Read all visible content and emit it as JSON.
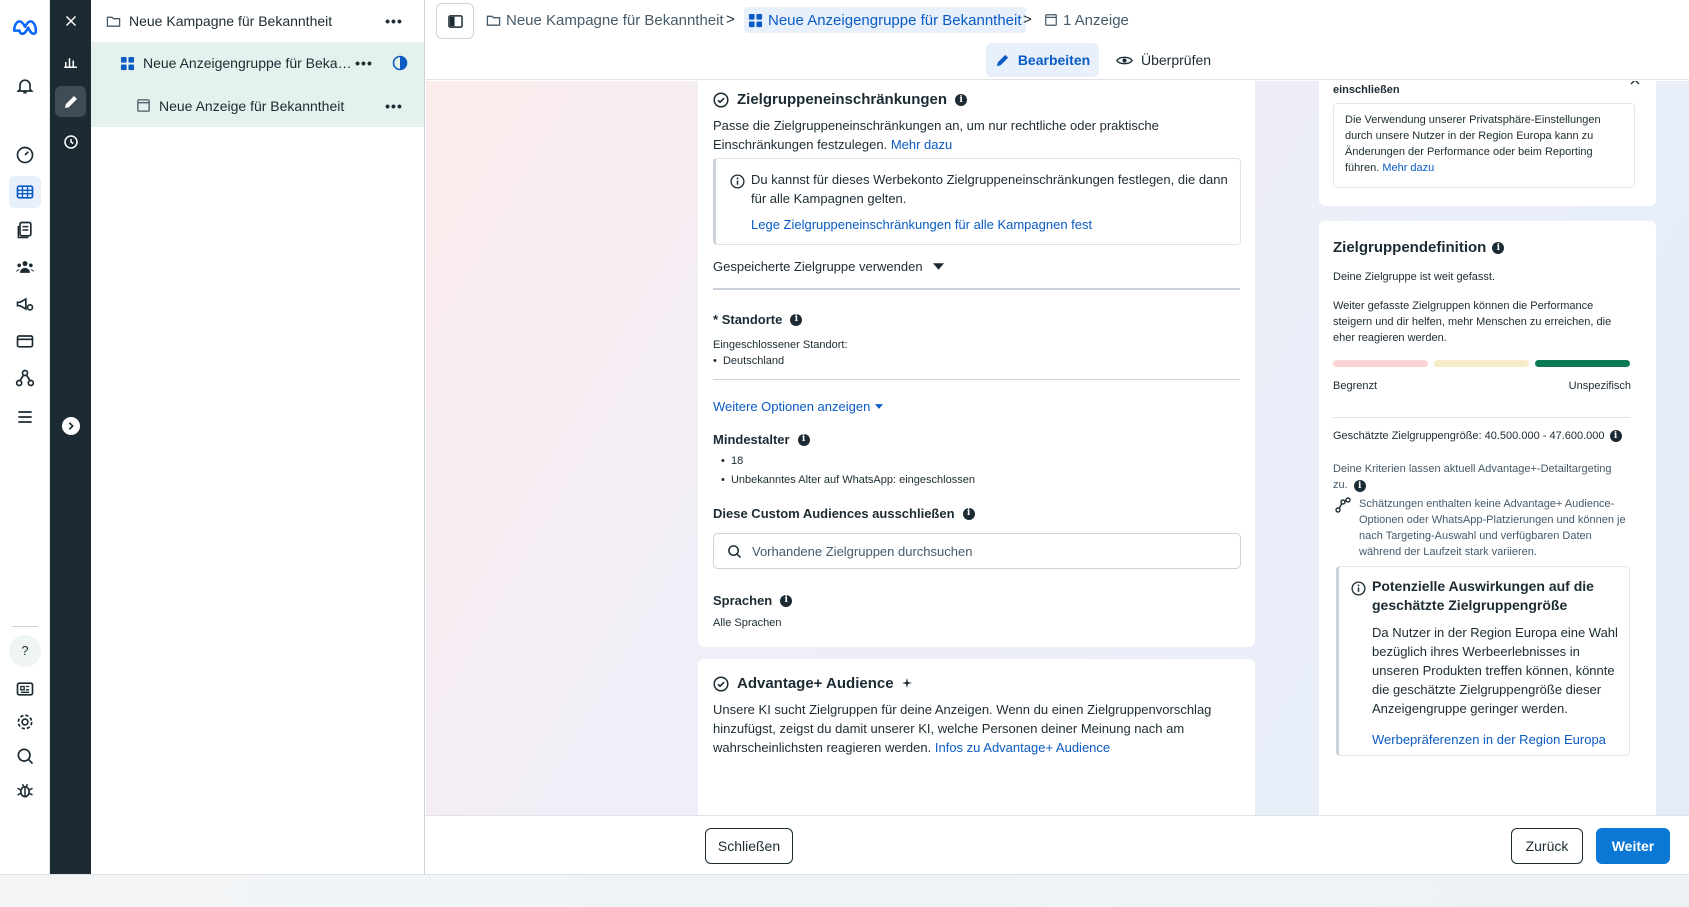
{
  "tree": {
    "campaign": "Neue Kampagne für Bekanntheit",
    "adset": "Neue Anzeigengruppe für Beka…",
    "ad": "Neue Anzeige für Bekanntheit"
  },
  "breadcrumb": {
    "campaign": "Neue Kampagne für Bekanntheit",
    "adset": "Neue Anzeigengruppe für Bekanntheit",
    "ad": "1 Anzeige"
  },
  "toolbar": {
    "edit_label": "Bearbeiten",
    "review_label": "Überprüfen"
  },
  "restrictions": {
    "title": "Zielgruppeneinschränkungen",
    "desc": "Passe die Zielgruppeneinschränkungen an, um nur rechtliche oder praktische Einschränkungen festzulegen.",
    "more": "Mehr dazu",
    "notice": "Du kannst für dieses Werbekonto Zielgruppeneinschränkungen festlegen, die dann für alle Kampagnen gelten.",
    "notice_link": "Lege Zielgruppeneinschränkungen für alle Kampagnen fest",
    "saved_audience": "Gespeicherte Zielgruppe verwenden",
    "locations_label": "Standorte",
    "locations_required": "*",
    "included_label": "Eingeschlossener Standort:",
    "location_1": "Deutschland",
    "more_options": "Weitere Optionen anzeigen",
    "min_age_label": "Mindestalter",
    "min_age_value": "18",
    "whatsapp_age": "Unbekanntes Alter auf WhatsApp: eingeschlossen",
    "exclude_label": "Diese Custom Audiences ausschließen",
    "search_placeholder": "Vorhandene Zielgruppen durchsuchen",
    "languages_label": "Sprachen",
    "languages_value": "Alle Sprachen"
  },
  "advantage": {
    "title": "Advantage+ Audience",
    "desc": "Unsere KI sucht Zielgruppen für deine Anzeigen. Wenn du einen Zielgruppenvorschlag hinzufügst, zeigst du damit unserer KI, welche Personen deiner Meinung nach am wahrscheinlichsten reagieren werden.",
    "link": "Infos zu Advantage+ Audience"
  },
  "privacy": {
    "heading": "einschließen",
    "text": "Die Verwendung unserer Privatsphäre-Einstellungen durch unsere Nutzer in der Region Europa kann zu Änderungen der Performance oder beim Reporting führen.",
    "link": "Mehr dazu"
  },
  "definition": {
    "title": "Zielgruppendefinition",
    "broad": "Deine Zielgruppe ist weit gefasst.",
    "explain": "Weiter gefasste Zielgruppen können die Performance steigern und dir helfen, mehr Menschen zu erreichen, die eher reagieren werden.",
    "meter_level": 1.0,
    "left_label": "Begrenzt",
    "right_label": "Unspezifisch",
    "size": "Geschätzte Zielgruppengröße: 40.500.000 - 47.600.000",
    "criteria": "Deine Kriterien lassen aktuell Advantage+-Detailtargeting zu.",
    "estimates": "Schätzungen enthalten keine Advantage+ Audience-Optionen oder WhatsApp-Platzierungen und können je nach Targeting-Auswahl und verfügbaren Daten während der Laufzeit stark variieren.",
    "impact_title": "Potenzielle Auswirkungen auf die geschätzte Zielgruppengröße",
    "impact_text": "Da Nutzer in der Region Europa eine Wahl bezüglich ihres Werbeerlebnisses in unseren Produkten treffen können, könnte die geschätzte Zielgruppengröße dieser Anzeigengruppe geringer werden.",
    "impact_link": "Werbepräferenzen in der Region Europa"
  },
  "footer": {
    "close": "Schließen",
    "back": "Zurück",
    "next": "Weiter"
  },
  "colors": {
    "accent": "#0a5bc4",
    "primary_button": "#0a78d4",
    "meter_good": "#0b7a55",
    "sidebar_dark": "#1c2b33"
  }
}
